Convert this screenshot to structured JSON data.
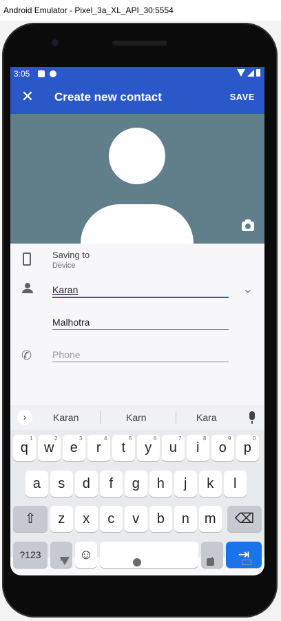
{
  "window": {
    "title": "Android Emulator - Pixel_3a_XL_API_30:5554"
  },
  "statusbar": {
    "time": "3:05"
  },
  "appbar": {
    "title": "Create new contact",
    "save_label": "SAVE"
  },
  "form": {
    "saving_to_label": "Saving to",
    "saving_to_value": "Device",
    "first_name": "Karan",
    "last_name": "Malhotra",
    "phone_placeholder": "Phone"
  },
  "keyboard": {
    "suggestions": [
      "Karan",
      "Karn",
      "Kara"
    ],
    "row1": [
      {
        "k": "q",
        "h": "1"
      },
      {
        "k": "w",
        "h": "2"
      },
      {
        "k": "e",
        "h": "3"
      },
      {
        "k": "r",
        "h": "4"
      },
      {
        "k": "t",
        "h": "5"
      },
      {
        "k": "y",
        "h": "6"
      },
      {
        "k": "u",
        "h": "7"
      },
      {
        "k": "i",
        "h": "8"
      },
      {
        "k": "o",
        "h": "9"
      },
      {
        "k": "p",
        "h": "0"
      }
    ],
    "row2": [
      "a",
      "s",
      "d",
      "f",
      "g",
      "h",
      "j",
      "k",
      "l"
    ],
    "row3": [
      "z",
      "x",
      "c",
      "v",
      "b",
      "n",
      "m"
    ],
    "symbols_label": "?123",
    "comma": ",",
    "period": "."
  },
  "colors": {
    "accent": "#2a58c8",
    "photo_bg": "#617e8b",
    "enter_key": "#1a73e8"
  }
}
